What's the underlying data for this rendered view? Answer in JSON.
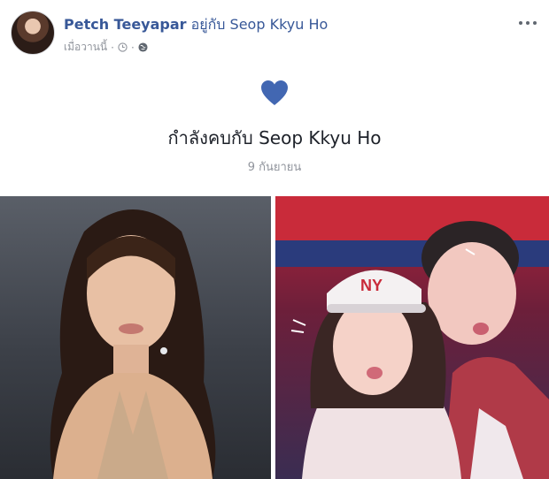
{
  "post": {
    "author": "Petch Teeyapar",
    "with_text": "อยู่กับ",
    "tagged_person": "Seop Kkyu Ho",
    "timestamp": "เมื่อวานนี้",
    "separator": "·",
    "icons": {
      "time": "clock-icon",
      "privacy": "globe-icon",
      "menu": "more-options-icon",
      "event": "heart-icon"
    }
  },
  "life_event": {
    "title": "กำลังคบกับ Seop Kkyu Ho",
    "date": "9 กันยายน"
  },
  "colors": {
    "link": "#385898",
    "heart": "#4267b2",
    "muted": "#90949c"
  },
  "photos": {
    "left": "portrait-photo",
    "right": "couple-selfie-photo"
  }
}
